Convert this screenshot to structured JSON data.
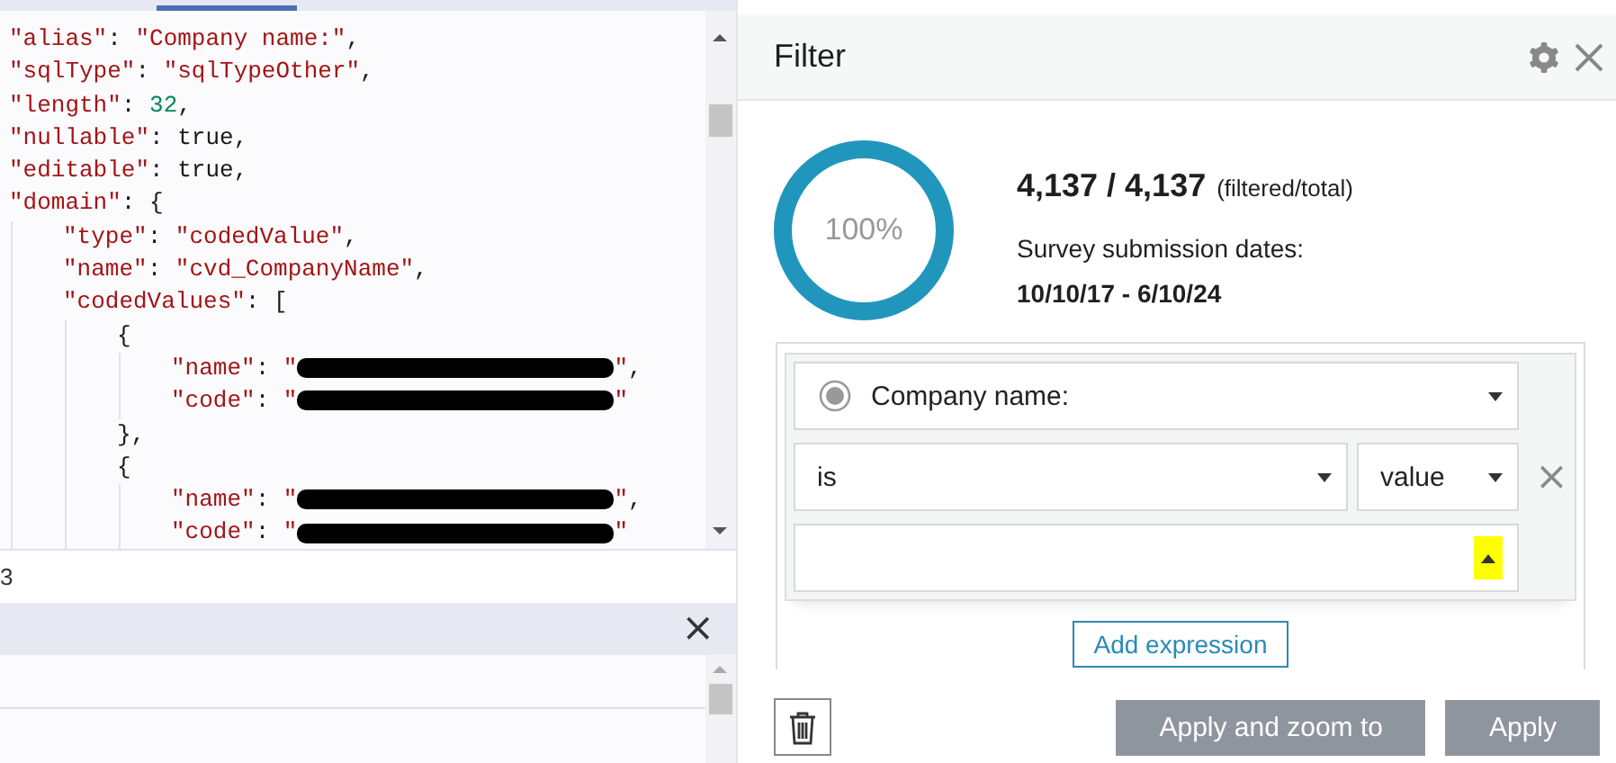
{
  "code_editor": {
    "lines": [
      {
        "tokens": [
          {
            "kind": "key",
            "text": "\"alias\""
          },
          {
            "kind": "punct",
            "text": ": "
          },
          {
            "kind": "string",
            "text": "\"Company name:\""
          },
          {
            "kind": "punct",
            "text": ","
          }
        ]
      },
      {
        "tokens": [
          {
            "kind": "key",
            "text": "\"sqlType\""
          },
          {
            "kind": "punct",
            "text": ": "
          },
          {
            "kind": "string",
            "text": "\"sqlTypeOther\""
          },
          {
            "kind": "punct",
            "text": ","
          }
        ]
      },
      {
        "tokens": [
          {
            "kind": "key",
            "text": "\"length\""
          },
          {
            "kind": "punct",
            "text": ": "
          },
          {
            "kind": "number",
            "text": "32"
          },
          {
            "kind": "punct",
            "text": ","
          }
        ]
      },
      {
        "tokens": [
          {
            "kind": "key",
            "text": "\"nullable\""
          },
          {
            "kind": "punct",
            "text": ": "
          },
          {
            "kind": "literal",
            "text": "true"
          },
          {
            "kind": "punct",
            "text": ","
          }
        ]
      },
      {
        "tokens": [
          {
            "kind": "key",
            "text": "\"editable\""
          },
          {
            "kind": "punct",
            "text": ": "
          },
          {
            "kind": "literal",
            "text": "true"
          },
          {
            "kind": "punct",
            "text": ","
          }
        ]
      },
      {
        "tokens": [
          {
            "kind": "key",
            "text": "\"domain\""
          },
          {
            "kind": "punct",
            "text": ": {"
          }
        ],
        "children": [
          {
            "tokens": [
              {
                "kind": "key",
                "text": "\"type\""
              },
              {
                "kind": "punct",
                "text": ": "
              },
              {
                "kind": "string",
                "text": "\"codedValue\""
              },
              {
                "kind": "punct",
                "text": ","
              }
            ]
          },
          {
            "tokens": [
              {
                "kind": "key",
                "text": "\"name\""
              },
              {
                "kind": "punct",
                "text": ": "
              },
              {
                "kind": "string",
                "text": "\"cvd_CompanyName\""
              },
              {
                "kind": "punct",
                "text": ","
              }
            ]
          },
          {
            "tokens": [
              {
                "kind": "key",
                "text": "\"codedValues\""
              },
              {
                "kind": "punct",
                "text": ": ["
              }
            ],
            "children": [
              {
                "tokens": [
                  {
                    "kind": "punct",
                    "text": "{"
                  }
                ],
                "children": [
                  {
                    "tokens": [
                      {
                        "kind": "key",
                        "text": "\"name\""
                      },
                      {
                        "kind": "punct",
                        "text": ": "
                      },
                      {
                        "kind": "string",
                        "text": "\""
                      },
                      {
                        "kind": "redacted"
                      },
                      {
                        "kind": "string",
                        "text": "\""
                      },
                      {
                        "kind": "punct",
                        "text": ","
                      }
                    ]
                  },
                  {
                    "tokens": [
                      {
                        "kind": "key",
                        "text": "\"code\""
                      },
                      {
                        "kind": "punct",
                        "text": ": "
                      },
                      {
                        "kind": "string",
                        "text": "\""
                      },
                      {
                        "kind": "redacted"
                      },
                      {
                        "kind": "string",
                        "text": "\""
                      }
                    ]
                  }
                ]
              },
              {
                "tokens": [
                  {
                    "kind": "punct",
                    "text": "},"
                  }
                ]
              },
              {
                "tokens": [
                  {
                    "kind": "punct",
                    "text": "{"
                  }
                ],
                "children": [
                  {
                    "tokens": [
                      {
                        "kind": "key",
                        "text": "\"name\""
                      },
                      {
                        "kind": "punct",
                        "text": ": "
                      },
                      {
                        "kind": "string",
                        "text": "\""
                      },
                      {
                        "kind": "redacted"
                      },
                      {
                        "kind": "string",
                        "text": "\""
                      },
                      {
                        "kind": "punct",
                        "text": ","
                      }
                    ]
                  },
                  {
                    "tokens": [
                      {
                        "kind": "key",
                        "text": "\"code\""
                      },
                      {
                        "kind": "punct",
                        "text": ": "
                      },
                      {
                        "kind": "string",
                        "text": "\""
                      },
                      {
                        "kind": "redacted"
                      },
                      {
                        "kind": "string",
                        "text": "\""
                      }
                    ]
                  }
                ]
              }
            ]
          }
        ]
      }
    ],
    "status_text": "3"
  },
  "bottom_panel": {
    "close": "×"
  },
  "filter": {
    "title": "Filter",
    "summary": {
      "level": 1,
      "percent": "100%",
      "count": "4,137 / 4,137",
      "count_note": "(filtered/total)",
      "dates_label": "Survey submission dates:",
      "dates": "10/10/17 - 6/10/24"
    },
    "expression": {
      "field": "Company name:",
      "operator": "is",
      "value_mode": "value",
      "remove": "×",
      "value_caret_highlighted": true
    },
    "add_expression": "Add expression",
    "buttons": [
      {
        "label": "Apply and zoom to",
        "disabled": true
      },
      {
        "label": "Apply",
        "disabled": true
      }
    ]
  }
}
